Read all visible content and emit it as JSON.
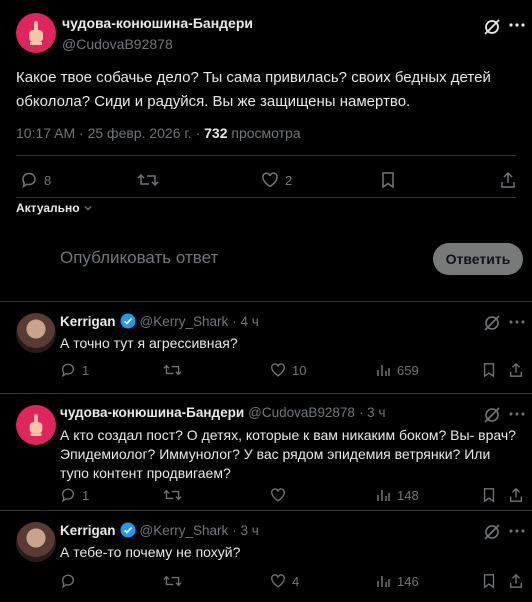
{
  "main_tweet": {
    "author_name": "чудова-конюшина-Бандери",
    "author_handle": "@CudovaB92878",
    "text": "Какое твое собачье дело? Ты сама привилась? своих бедных детей обколола? Сиди и радуйся. Вы же защищены намертво.",
    "time": "10:17 AM · 25 февр. 2026 г. · ",
    "views_count": "732",
    "views_label": " просмотра",
    "replies": "8",
    "retweets": "",
    "likes": "2"
  },
  "sort_label": "Актуально",
  "reply_composer": {
    "placeholder": "Опубликовать ответ",
    "button": "Ответить"
  },
  "replies": [
    {
      "name": "Kerrigan",
      "handle": "@Kerry_Shark",
      "time": "· 4 ч",
      "verified": true,
      "text": "А точно тут я агрессивная?",
      "replies": "1",
      "retweets": "",
      "likes": "10",
      "views": "659"
    },
    {
      "name": "чудова-конюшина-Бандери",
      "handle": "@CudovaB92878",
      "time": "· 3 ч",
      "verified": false,
      "text": "А кто создал пост? О детях, которые к вам никаким боком? Вы- врач? Эпидемиолог? Иммунолог? У вас рядом эпидемия ветрянки? Или тупо контент продвигаем?",
      "replies": "1",
      "retweets": "",
      "likes": "",
      "views": "148"
    },
    {
      "name": "Kerrigan",
      "handle": "@Kerry_Shark",
      "time": "· 3 ч",
      "verified": true,
      "text": "А тебе-то почему не похуй?",
      "replies": "",
      "retweets": "",
      "likes": "4",
      "views": "146"
    }
  ],
  "colors": {
    "background": "#000000",
    "text": "#e7e9ea",
    "muted": "#71767b",
    "border": "#2f3336",
    "verified": "#1d9bf0",
    "avatar_accent": "#e0245e"
  }
}
